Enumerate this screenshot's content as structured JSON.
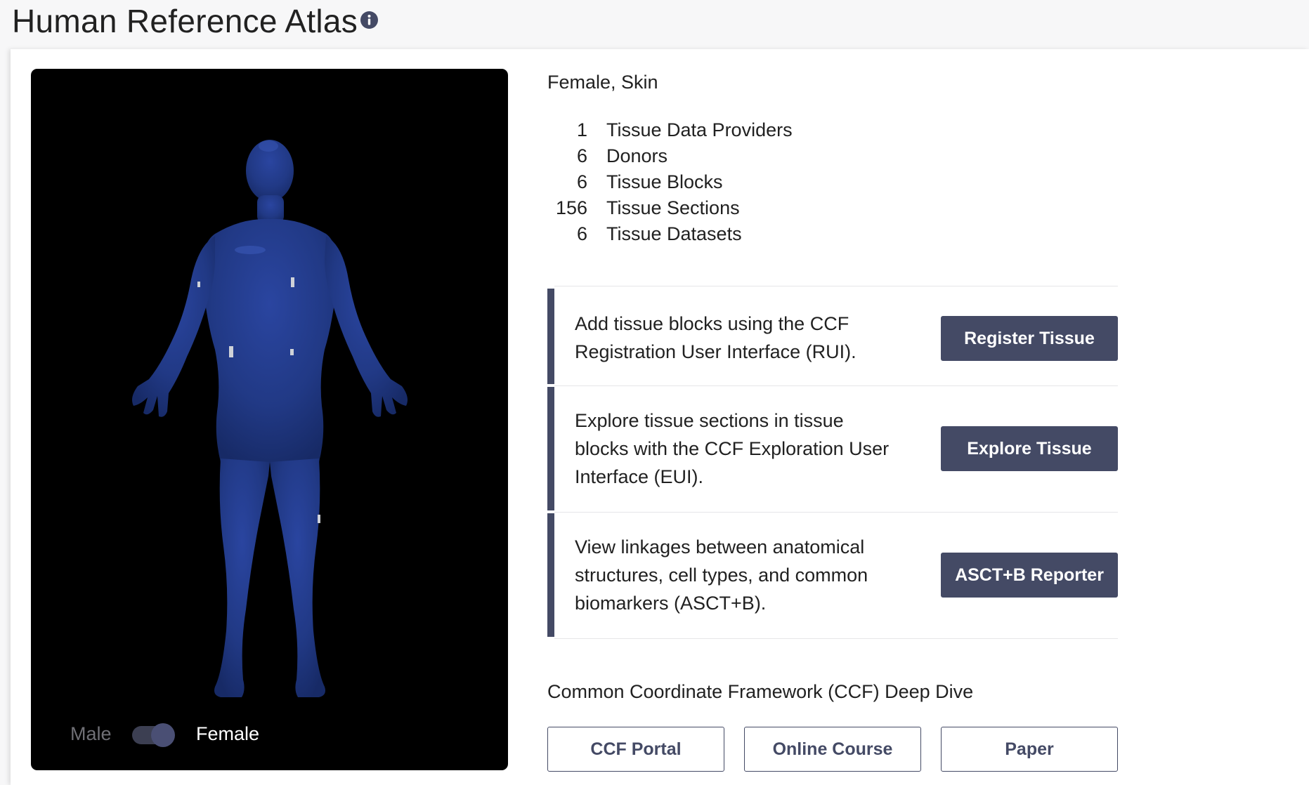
{
  "header": {
    "title": "Human Reference Atlas",
    "info_icon": "info-circle-icon"
  },
  "viewer": {
    "background": "#000000",
    "body_color": "#223a86",
    "sex_toggle": {
      "male_label": "Male",
      "female_label": "Female",
      "selected": "Female"
    }
  },
  "summary": {
    "title": "Female, Skin",
    "stats": [
      {
        "count": "1",
        "label": "Tissue Data Providers"
      },
      {
        "count": "6",
        "label": "Donors"
      },
      {
        "count": "6",
        "label": "Tissue Blocks"
      },
      {
        "count": "156",
        "label": "Tissue Sections"
      },
      {
        "count": "6",
        "label": "Tissue Datasets"
      }
    ]
  },
  "actions": [
    {
      "lines": [
        "Add tissue blocks using the CCF",
        "Registration User Interface (RUI)."
      ],
      "button": "Register Tissue"
    },
    {
      "lines": [
        "Explore tissue sections in tissue",
        "blocks with the CCF Exploration User",
        "Interface (EUI)."
      ],
      "button": "Explore Tissue"
    },
    {
      "lines": [
        "View linkages between anatomical",
        "structures, cell types, and common",
        "biomarkers (ASCT+B)."
      ],
      "button": "ASCT+B Reporter"
    }
  ],
  "deep_dive": {
    "title": "Common Coordinate Framework (CCF) Deep Dive",
    "buttons": [
      "CCF Portal",
      "Online Course",
      "Paper"
    ]
  },
  "colors": {
    "accent": "#444a65",
    "text": "#212121",
    "page_bg": "#f7f7f8"
  }
}
